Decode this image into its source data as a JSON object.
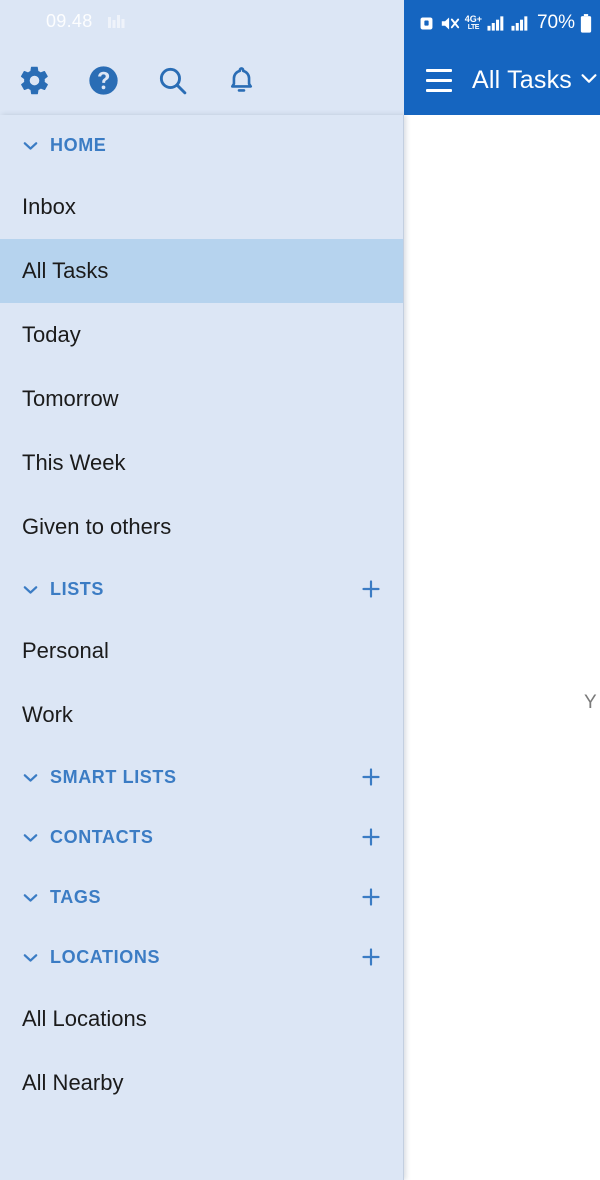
{
  "status_bar": {
    "time": "09.48",
    "time_icon": "media-indicator-icon",
    "icons": [
      "alarm-icon",
      "volume-mute-icon",
      "network-4g-plus-icon",
      "signal-bars-sim1-icon",
      "signal-bars-sim2-icon"
    ],
    "network_label_primary": "4G+",
    "network_label_secondary": "LTE",
    "battery_percent": "70%",
    "battery_icon": "battery-icon",
    "bg_color_left": "#dce6f5",
    "bg_color_right": "#1565c0"
  },
  "toolbar": {
    "icons": [
      {
        "name": "settings-gear-icon",
        "label": "Settings"
      },
      {
        "name": "help-circle-icon",
        "label": "Help"
      },
      {
        "name": "search-icon",
        "label": "Search"
      },
      {
        "name": "notifications-bell-icon",
        "label": "Notifications"
      }
    ]
  },
  "app_bar": {
    "menu_icon": "hamburger-menu-icon",
    "title": "All Tasks",
    "caret_icon": "chevron-down-icon",
    "bg_color": "#1565c0"
  },
  "content": {
    "ghost_text": "Y"
  },
  "drawer": {
    "accent_color": "#3b7cc4",
    "bg_color": "#dce6f5",
    "selected_bg_color": "#b6d3ee",
    "add_icon": "plus-icon",
    "caret_icon": "chevron-down-icon",
    "sections": [
      {
        "label": "HOME",
        "expanded": true,
        "has_add": false,
        "items": [
          {
            "label": "Inbox",
            "selected": false
          },
          {
            "label": "All Tasks",
            "selected": true
          },
          {
            "label": "Today",
            "selected": false
          },
          {
            "label": "Tomorrow",
            "selected": false
          },
          {
            "label": "This Week",
            "selected": false
          },
          {
            "label": "Given to others",
            "selected": false
          }
        ]
      },
      {
        "label": "LISTS",
        "expanded": true,
        "has_add": true,
        "items": [
          {
            "label": "Personal",
            "selected": false
          },
          {
            "label": "Work",
            "selected": false
          }
        ]
      },
      {
        "label": "SMART LISTS",
        "expanded": true,
        "has_add": true,
        "items": []
      },
      {
        "label": "CONTACTS",
        "expanded": true,
        "has_add": true,
        "items": []
      },
      {
        "label": "TAGS",
        "expanded": true,
        "has_add": true,
        "items": []
      },
      {
        "label": "LOCATIONS",
        "expanded": true,
        "has_add": true,
        "items": [
          {
            "label": "All Locations",
            "selected": false
          },
          {
            "label": "All Nearby",
            "selected": false
          }
        ]
      }
    ]
  }
}
